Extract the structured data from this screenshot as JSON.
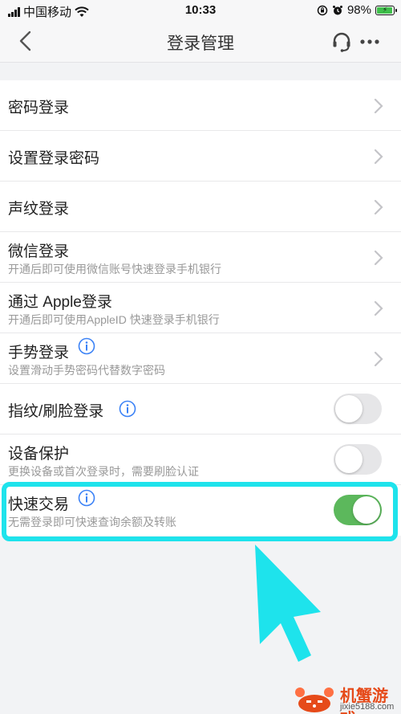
{
  "status": {
    "carrier": "中国移动",
    "time": "10:33",
    "battery": "98%",
    "wifi_icon": "wifi-icon",
    "battery_level": 0.98
  },
  "nav": {
    "title": "登录管理"
  },
  "colors": {
    "toggle_on": "#5cb85c",
    "toggle_off": "#e6e6e8",
    "highlight": "#1ee3ec",
    "info_icon": "#3b82f6"
  },
  "rows": [
    {
      "label": "密码登录",
      "desc": "",
      "control": "chevron"
    },
    {
      "label": "设置登录密码",
      "desc": "",
      "control": "chevron"
    },
    {
      "label": "声纹登录",
      "desc": "",
      "control": "chevron"
    },
    {
      "label": "微信登录",
      "desc": "开通后即可使用微信账号快速登录手机银行",
      "control": "chevron"
    },
    {
      "label": "通过 Apple登录",
      "desc": "开通后即可使用AppleID 快速登录手机银行",
      "control": "chevron"
    },
    {
      "label": "手势登录",
      "desc": "设置滑动手势密码代替数字密码",
      "control": "chevron",
      "info": true
    },
    {
      "label": "指纹/刷脸登录",
      "desc": "",
      "control": "toggle",
      "toggle_on": false,
      "info": true
    },
    {
      "label": "设备保护",
      "desc": "更换设备或首次登录时，需要刷脸认证",
      "control": "toggle",
      "toggle_on": false
    },
    {
      "label": "快速交易",
      "desc": "无需登录即可快速查询余额及转账",
      "control": "toggle",
      "toggle_on": true,
      "info": true
    }
  ],
  "watermark": {
    "name": "机蟹游戏",
    "url": "jixie5188.com"
  }
}
